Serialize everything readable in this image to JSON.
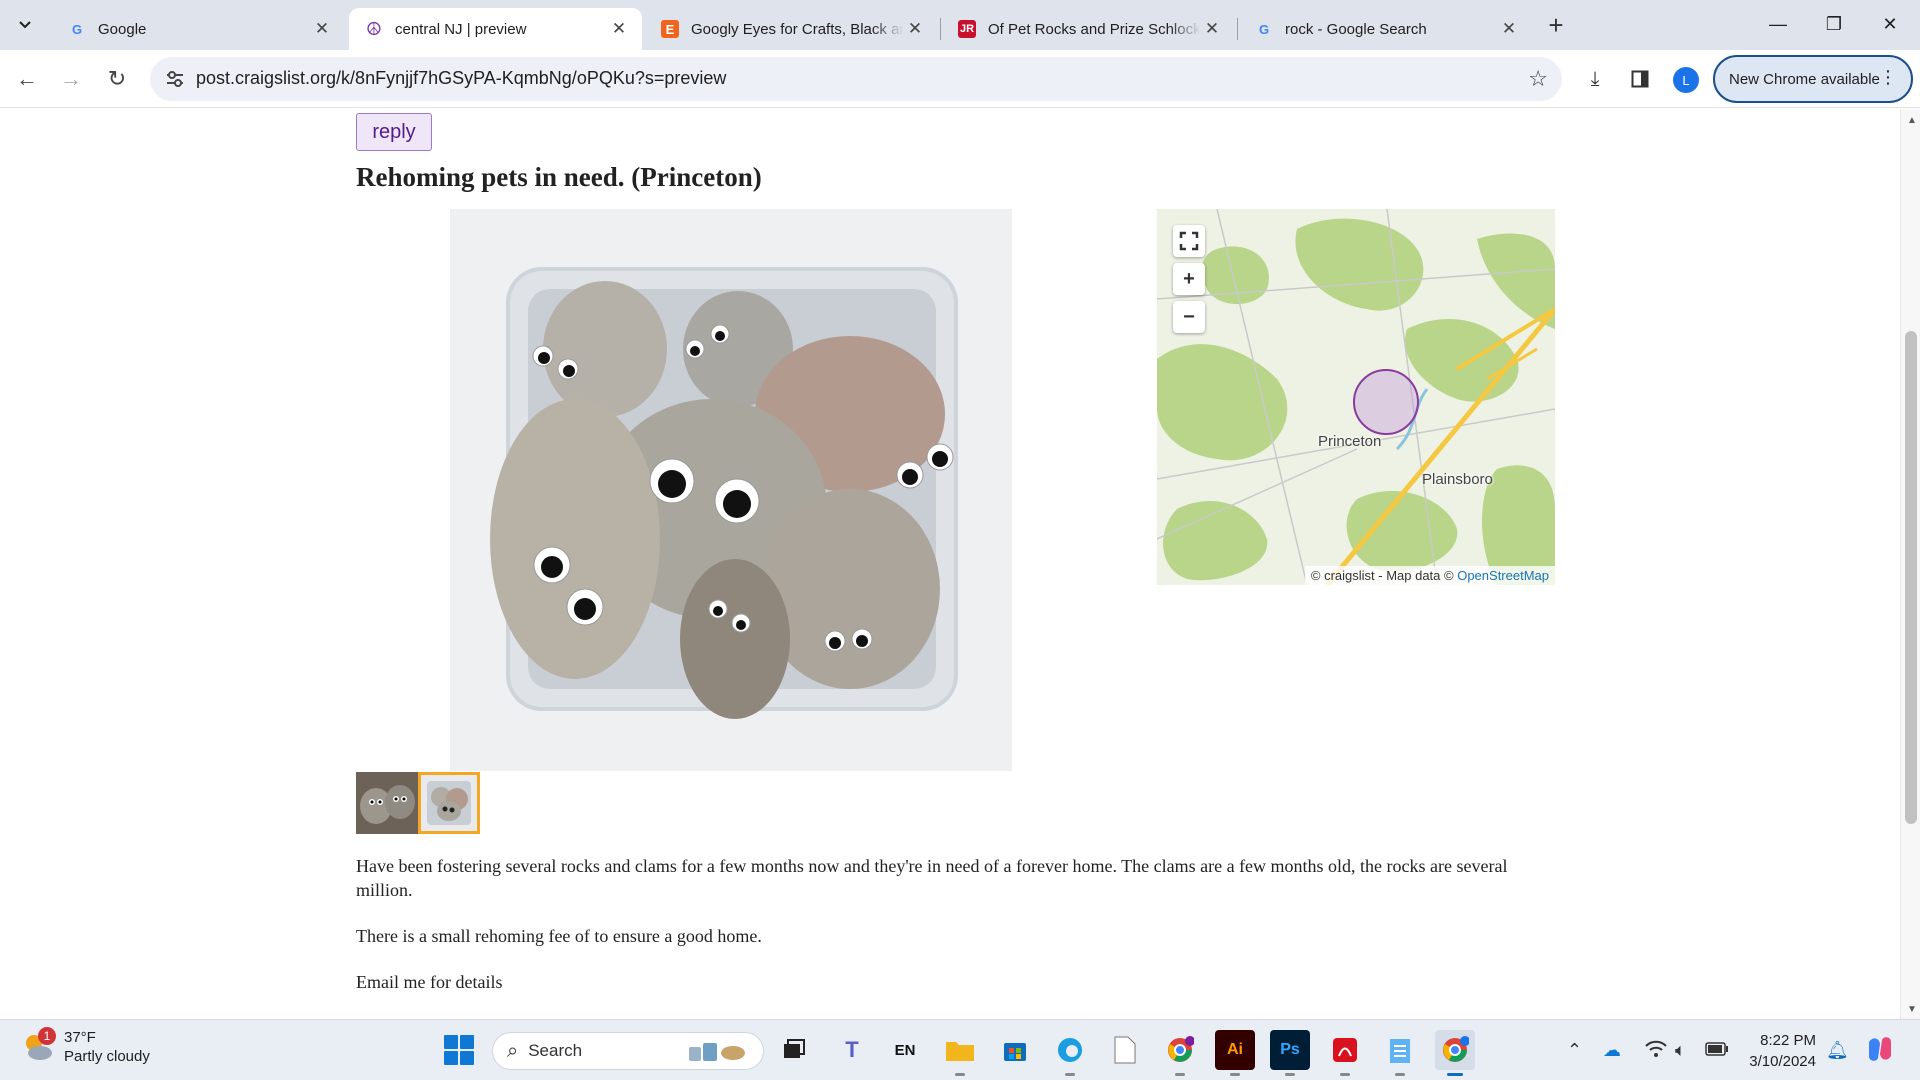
{
  "browser": {
    "tabs": [
      {
        "title": "Google",
        "favicon": "google-icon",
        "active": false
      },
      {
        "title": "central NJ | preview",
        "favicon": "peace-icon",
        "active": true
      },
      {
        "title": "Googly Eyes for Crafts, Black an",
        "favicon": "etsy-icon",
        "active": false
      },
      {
        "title": "Of Pet Rocks and Prize Schlock",
        "favicon": "jr-icon",
        "active": false
      },
      {
        "title": "rock - Google Search",
        "favicon": "google-icon",
        "active": false
      }
    ],
    "url": "post.craigslist.org/k/8nFynjjf7hGSyPA-KqmbNg/oPQKu?s=preview",
    "update_label": "New Chrome available",
    "profile_initial": "L"
  },
  "page": {
    "reply_label": "reply",
    "title": "Rehoming pets in need. (Princeton)",
    "map": {
      "labels": [
        "Princeton",
        "Plainsboro"
      ],
      "attribution_prefix": "© craigslist - Map data ©",
      "attribution_link": "OpenStreetMap",
      "controls": [
        "fullscreen-icon",
        "zoom-in-icon",
        "zoom-out-icon"
      ]
    },
    "body": [
      "Have been fostering several rocks and clams for a few months now and they're in need of a forever home. The clams are a few months old, the rocks are several million.",
      "There is a small rehoming fee of to ensure a good home.",
      "Email me for details"
    ]
  },
  "taskbar": {
    "weather_temp": "37°F",
    "weather_desc": "Partly cloudy",
    "weather_badge": "1",
    "search_placeholder": "Search",
    "lang": "EN",
    "time": "8:22 PM",
    "date": "3/10/2024"
  },
  "colors": {
    "accent": "#1a73e8",
    "reply_bg": "#efe6f7",
    "reply_text": "#551a8b",
    "thumb_selected": "#f5a623"
  }
}
